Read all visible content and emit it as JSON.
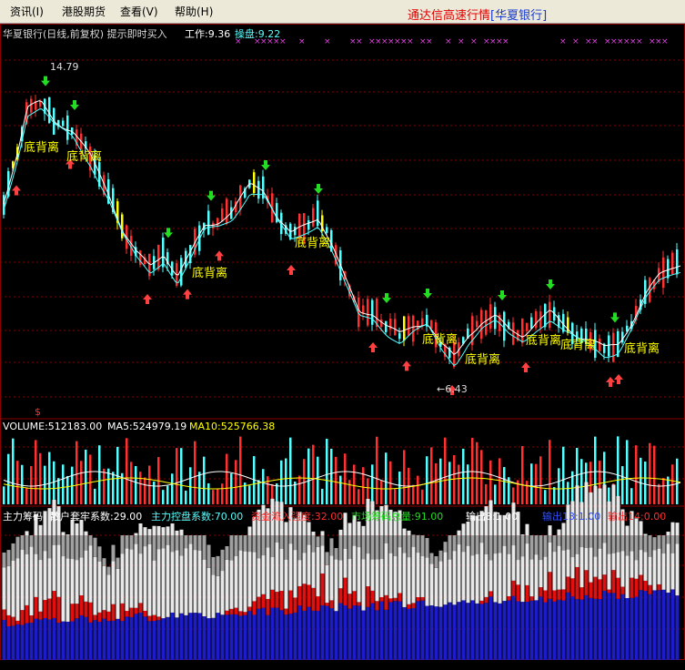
{
  "menu": {
    "items": [
      "资讯(I)",
      "港股期货",
      "查看(V)",
      "帮助(H)"
    ]
  },
  "app_title": {
    "prefix": "通达信高速行情",
    "stock": "[华夏银行]"
  },
  "main_panel": {
    "title": "华夏银行(日线,前复权) 提示即时买入",
    "work_label": "工作:9.36",
    "trade_label": "操盘:9.22",
    "high_label": "14.79",
    "low_label": "←6.43",
    "divergence_label": "底背离",
    "marker": "$"
  },
  "volume_panel": {
    "volume_label": "VOLUME:512183.00",
    "ma5_label": "MA5:524979.19",
    "ma10_label": "MA10:525766.38"
  },
  "chip_panel": {
    "name": "主力筹码",
    "retail_label": "散户套牢系数:29.00",
    "control_label": "主力控盘系数:70.00",
    "inflow_label": "资金流入强度:32.00",
    "total_label": "市场筹码总量:91.00",
    "out8_label": "输出8:1.00",
    "out13_label": "输出13:1.00",
    "out14_label": "输出14:0.00"
  },
  "colors": {
    "up": "#ff3030",
    "down": "#54ffff",
    "yellow_bar": "#ffff00",
    "ma_white": "#ffffff",
    "ma_cyan": "#54ffff",
    "buy_arrow": "#ff4040",
    "sell_arrow": "#22dd22",
    "grid": "#8b0000",
    "blue_fill": "#1c1cc8",
    "red_fill": "#e01010",
    "white_fill": "#e8e8e8",
    "gray_fill": "#a0a0a0"
  }
}
